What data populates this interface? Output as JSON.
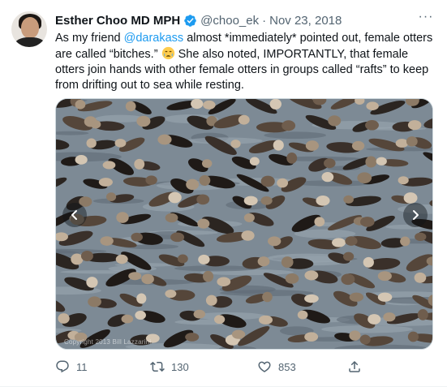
{
  "tweet": {
    "author_name": "Esther Choo MD MPH",
    "handle": "@choo_ek",
    "separator": "·",
    "date": "Nov 23, 2018",
    "more_label": "···",
    "text_part1": "As my friend ",
    "mention": "@darakass",
    "text_part2": " almost *immediately* pointed out, female otters are called “bitches.” ",
    "text_part3": " She also noted, IMPORTANTLY, that female otters join hands with other female otters in groups called “rafts” to keep from drifting out to sea while resting.",
    "media_watermark": "Copyright 2013 Bill Lazzarini"
  },
  "actions": {
    "reply_count": "11",
    "retweet_count": "130",
    "like_count": "853"
  },
  "icons": {
    "verified": "verified-badge-icon",
    "emoji": "crying-face-emoji",
    "reply": "reply-icon",
    "retweet": "retweet-icon",
    "like": "heart-icon",
    "share": "share-icon",
    "prev": "chevron-left-icon",
    "next": "chevron-right-icon"
  },
  "colors": {
    "accent": "#1d9bf0",
    "text_primary": "#0f1419",
    "text_secondary": "#536471"
  }
}
